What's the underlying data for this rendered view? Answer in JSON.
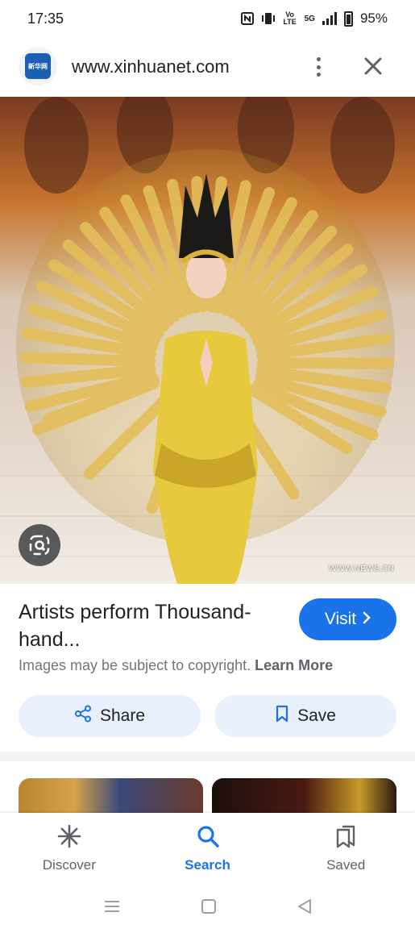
{
  "status_bar": {
    "time": "17:35",
    "network_labels": [
      "Vo LTE",
      "5G"
    ],
    "battery": "95%"
  },
  "url_bar": {
    "site_logo_text": "新华网",
    "url": "www.xinhuanet.com"
  },
  "image": {
    "watermark": "WWW.NEWS.CN"
  },
  "result": {
    "title": "Artists perform Thousand-hand...",
    "visit_label": "Visit",
    "copyright_text": "Images may be subject to copyright.",
    "learn_more_label": "Learn More"
  },
  "actions": {
    "share_label": "Share",
    "save_label": "Save"
  },
  "bottom_nav": {
    "items": [
      {
        "label": "Discover",
        "icon": "asterisk-icon"
      },
      {
        "label": "Search",
        "icon": "search-icon"
      },
      {
        "label": "Saved",
        "icon": "bookmarks-icon"
      }
    ],
    "active": "Search"
  },
  "colors": {
    "accent": "#1a73e8",
    "pill_bg": "#e8f0fe",
    "muted_text": "#70757a"
  }
}
